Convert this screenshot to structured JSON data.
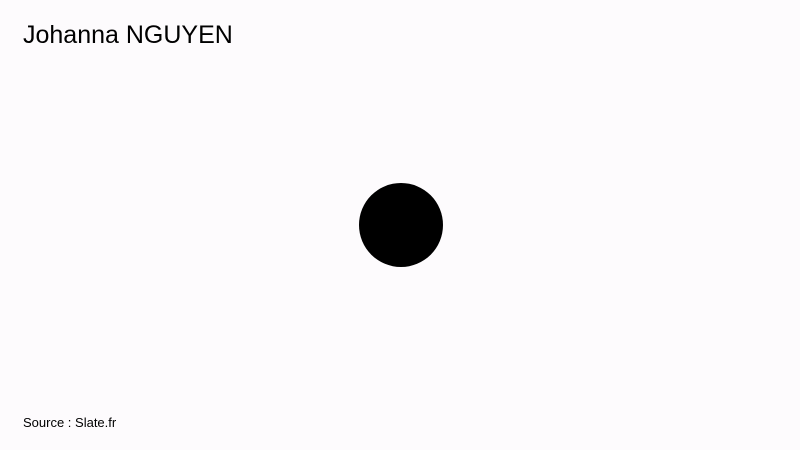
{
  "header": {
    "title": "Johanna NGUYEN"
  },
  "footer": {
    "source": "Source : Slate.fr"
  },
  "colors": {
    "background": "#fdfbfd",
    "dot": "#000000",
    "text": "#000000"
  }
}
